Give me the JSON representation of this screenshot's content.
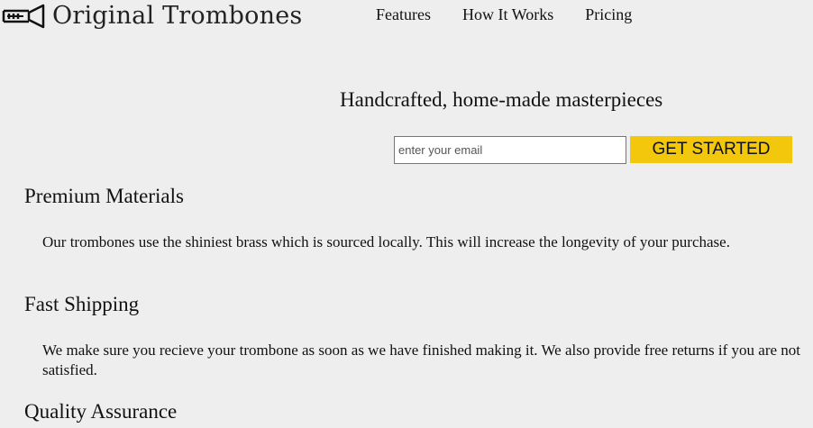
{
  "brand": {
    "name": "Original Trombones",
    "icon": "trombone-icon"
  },
  "nav": {
    "items": [
      {
        "label": "Features"
      },
      {
        "label": "How It Works"
      },
      {
        "label": "Pricing"
      }
    ]
  },
  "hero": {
    "title": "Handcrafted, home-made masterpieces",
    "email_placeholder": "enter your email",
    "cta_label": "GET STARTED",
    "cta_color": "#f2c70c"
  },
  "features": [
    {
      "title": "Premium Materials",
      "text": "Our trombones use the shiniest brass which is sourced locally. This will increase the longevity of your purchase."
    },
    {
      "title": "Fast Shipping",
      "text": "We make sure you recieve your trombone as soon as we have finished making it. We also provide free returns if you are not satisfied."
    },
    {
      "title": "Quality Assurance"
    }
  ]
}
